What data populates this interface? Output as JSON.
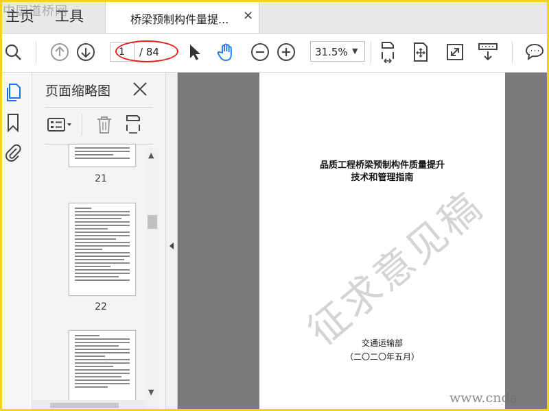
{
  "watermark_site": "中国道桥网",
  "tabs": {
    "home": "主页",
    "tools": "工具",
    "document": "桥梁预制构件量提...",
    "close_symbol": "×"
  },
  "toolbar": {
    "current_page": "1",
    "total_pages": "/ 84",
    "zoom": "31.5%"
  },
  "thumbnail_panel": {
    "title": "页面缩略图",
    "pages": [
      "21",
      "22"
    ]
  },
  "document": {
    "title_line1": "品质工程桥梁预制构件质量提升",
    "title_line2": "技术和管理指南",
    "draft_watermark": "征求意见稿",
    "issuer": "交通运输部",
    "date": "（二〇二〇年五月）"
  },
  "url_watermark": "www.cnda",
  "colors": {
    "accent_blue": "#1473e6",
    "annotation_red": "#e0231c",
    "frame_yellow": "#f2d21a"
  },
  "icons": [
    "search-icon",
    "prev-page-icon",
    "next-page-icon",
    "select-cursor-icon",
    "hand-icon",
    "zoom-out-icon",
    "zoom-in-icon",
    "fit-width-icon",
    "full-screen-icon",
    "expand-icon",
    "scroll-mode-icon",
    "comment-icon",
    "pages-icon",
    "bookmark-icon",
    "attachment-icon",
    "options-icon",
    "trash-icon"
  ]
}
